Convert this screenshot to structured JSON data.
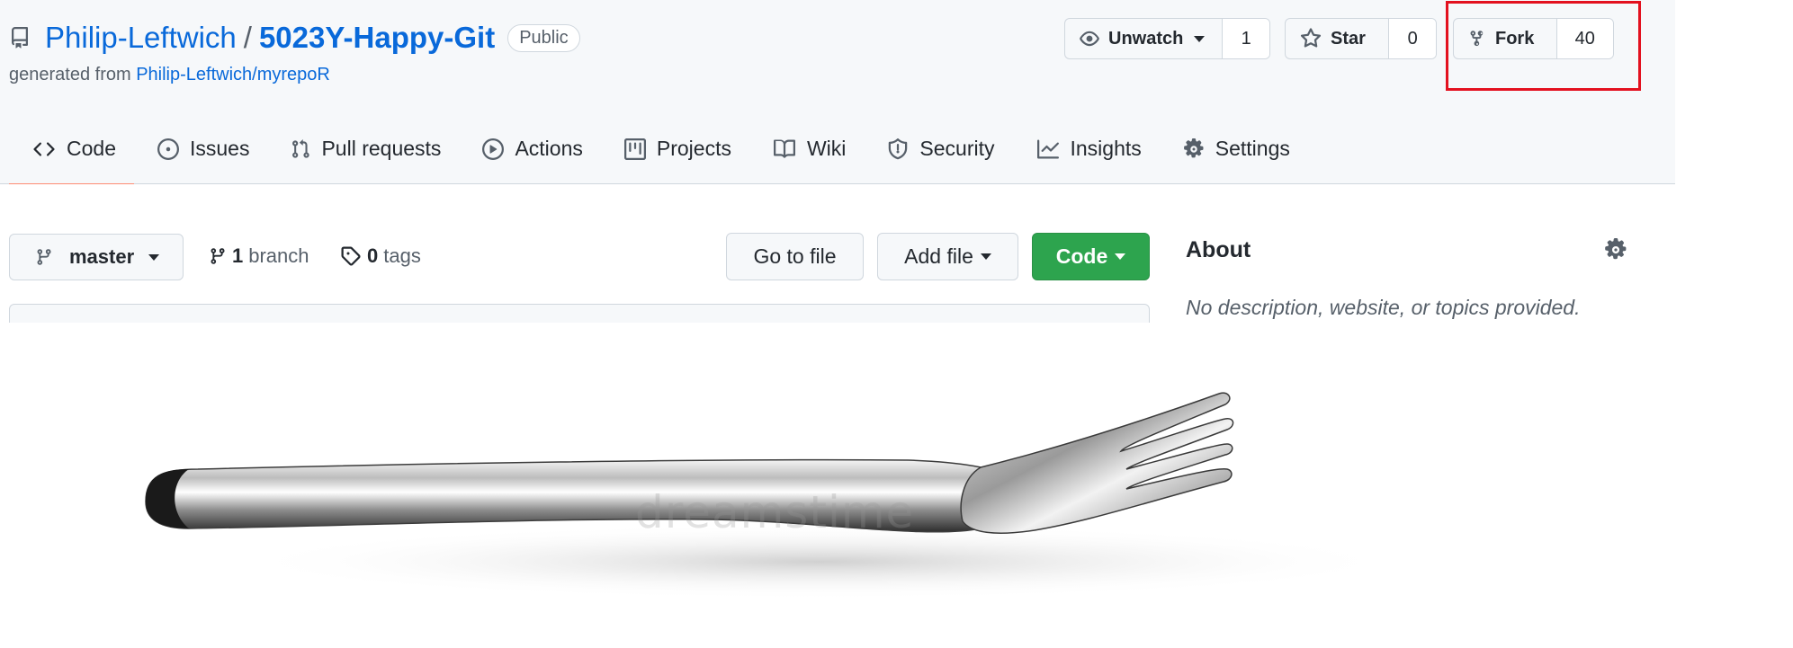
{
  "repo": {
    "owner": "Philip-Leftwich",
    "separator": "/",
    "name": "5023Y-Happy-Git",
    "visibility": "Public",
    "generated_prefix": "generated from",
    "generated_from": "Philip-Leftwich/myrepoR"
  },
  "actions": {
    "watch_label": "Unwatch",
    "watch_count": "1",
    "star_label": "Star",
    "star_count": "0",
    "fork_label": "Fork",
    "fork_count": "40"
  },
  "tabs": [
    {
      "label": "Code",
      "icon": "code-icon"
    },
    {
      "label": "Issues",
      "icon": "issue-icon"
    },
    {
      "label": "Pull requests",
      "icon": "pull-request-icon"
    },
    {
      "label": "Actions",
      "icon": "play-icon"
    },
    {
      "label": "Projects",
      "icon": "project-icon"
    },
    {
      "label": "Wiki",
      "icon": "book-icon"
    },
    {
      "label": "Security",
      "icon": "shield-icon"
    },
    {
      "label": "Insights",
      "icon": "graph-icon"
    },
    {
      "label": "Settings",
      "icon": "gear-icon"
    }
  ],
  "toolbar": {
    "branch": "master",
    "branch_count": "1",
    "branch_word": "branch",
    "tag_count": "0",
    "tag_word": "tags",
    "go_to_file": "Go to file",
    "add_file": "Add file",
    "code": "Code"
  },
  "about": {
    "title": "About",
    "description": "No description, website, or topics provided."
  },
  "photo": {
    "subject": "fork",
    "watermark": "dreamstime"
  },
  "colors": {
    "link": "#0969da",
    "highlight": "#e3111f",
    "code_button": "#2da44e",
    "active_tab_underline": "#fd8c73"
  }
}
